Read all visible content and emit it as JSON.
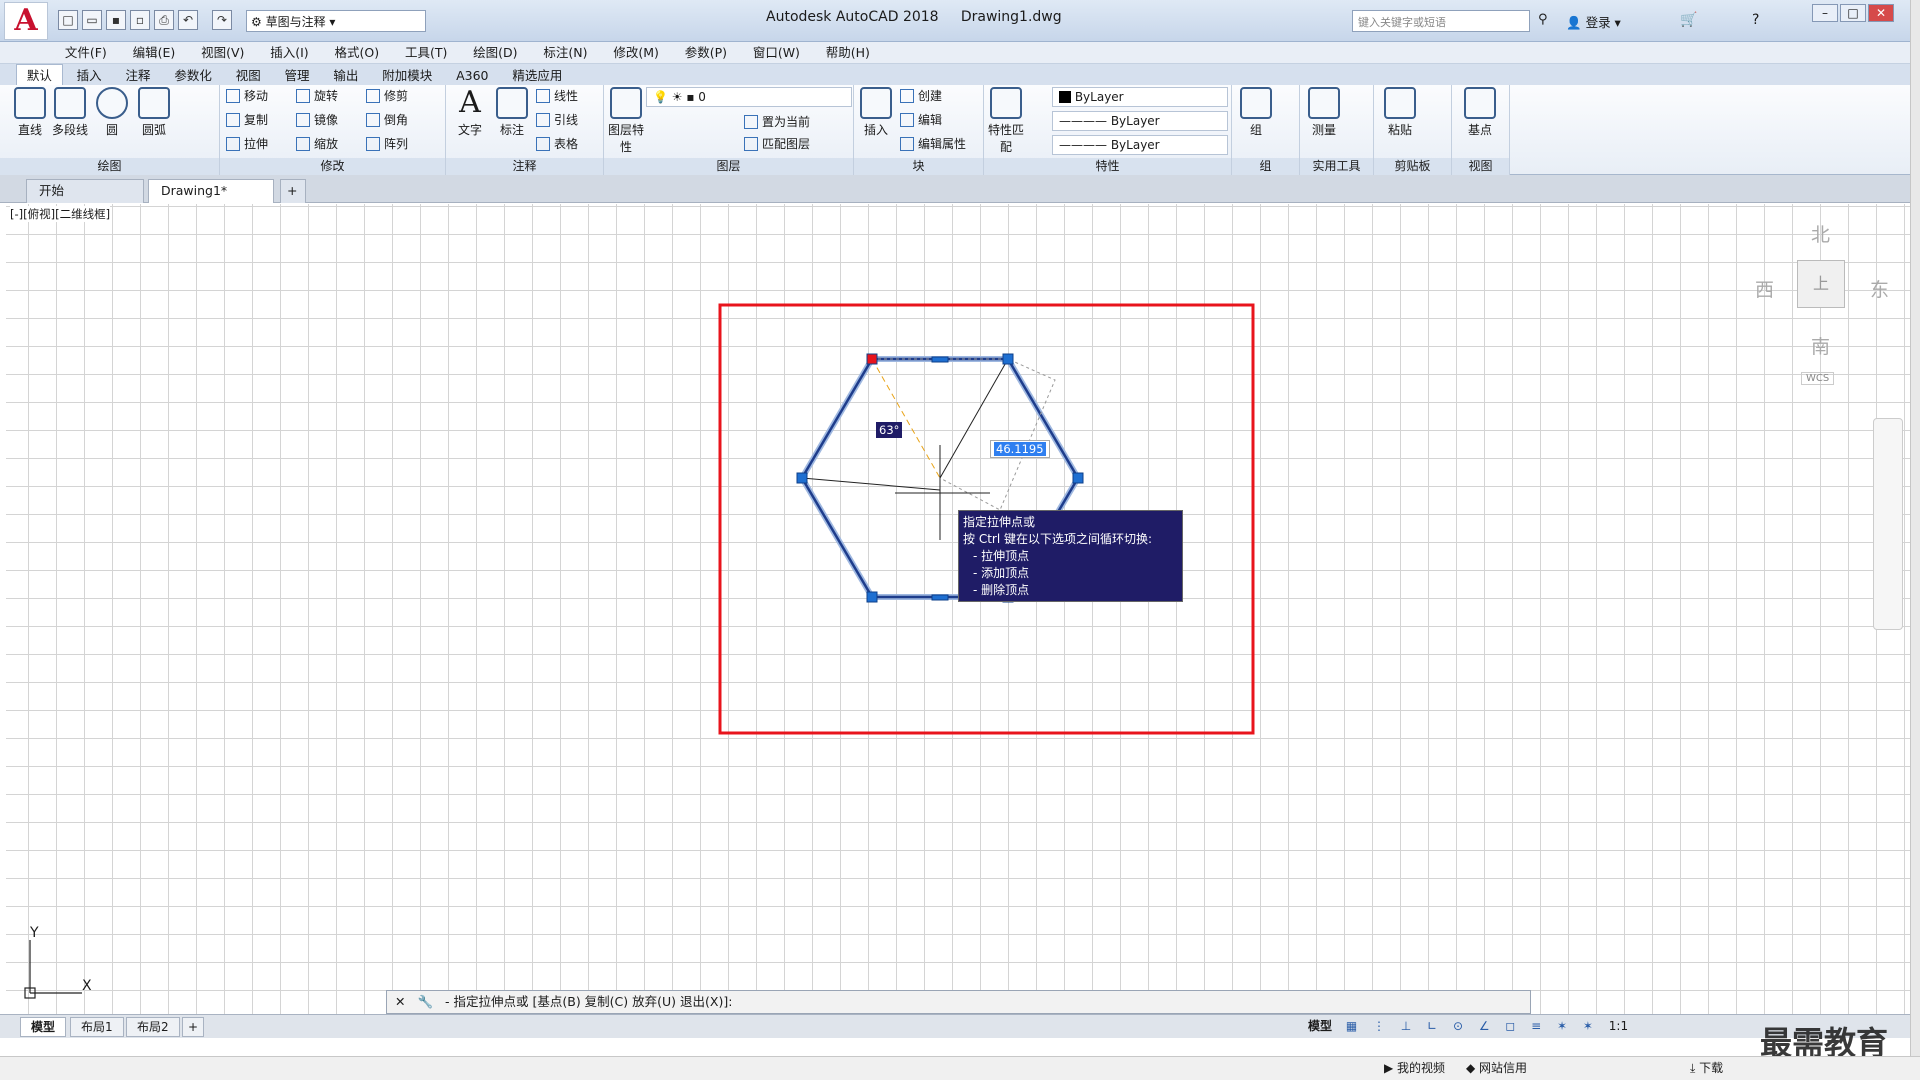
{
  "title": {
    "app": "Autodesk AutoCAD 2018",
    "file": "Drawing1.dwg",
    "workspace": "草图与注释",
    "search_placeholder": "键入关键字或短语",
    "login": "登录"
  },
  "menus": [
    "文件(F)",
    "编辑(E)",
    "视图(V)",
    "插入(I)",
    "格式(O)",
    "工具(T)",
    "绘图(D)",
    "标注(N)",
    "修改(M)",
    "参数(P)",
    "窗口(W)",
    "帮助(H)"
  ],
  "ribbon_tabs": [
    "默认",
    "插入",
    "注释",
    "参数化",
    "视图",
    "管理",
    "输出",
    "附加模块",
    "A360",
    "精选应用"
  ],
  "panels": {
    "draw": {
      "title": "绘图",
      "line": "直线",
      "polyline": "多段线",
      "circle": "圆",
      "arc": "圆弧"
    },
    "modify": {
      "title": "修改",
      "move": "移动",
      "rotate": "旋转",
      "trim": "修剪",
      "copy": "复制",
      "mirror": "镜像",
      "fillet": "倒角",
      "stretch": "拉伸",
      "scale": "缩放",
      "array": "阵列"
    },
    "annotation": {
      "title": "注释",
      "text": "文字",
      "dimension": "标注",
      "linear": "线性",
      "leader": "引线",
      "table": "表格"
    },
    "layers": {
      "title": "图层",
      "props": "图层特性",
      "current_layer": "0",
      "make_current": "置为当前",
      "match": "匹配图层"
    },
    "block": {
      "title": "块",
      "insert": "插入",
      "create": "创建",
      "edit": "编辑",
      "edit_attr": "编辑属性"
    },
    "properties": {
      "title": "特性",
      "match": "特性匹配",
      "color": "ByLayer",
      "linetype": "ByLayer",
      "lineweight": "ByLayer"
    },
    "groups": {
      "title": "组",
      "group": "组"
    },
    "utilities": {
      "title": "实用工具",
      "measure": "测量"
    },
    "clipboard": {
      "title": "剪贴板",
      "paste": "粘贴"
    },
    "view": {
      "title": "视图",
      "base": "基点"
    }
  },
  "doc_tabs": [
    "开始",
    "Drawing1*"
  ],
  "viewport_label": "[-][俯视][二维线框]",
  "viewcube": {
    "north": "北",
    "south": "南",
    "east": "东",
    "west": "西",
    "center": "上",
    "wcs": "WCS"
  },
  "dynamic_input": {
    "angle": "63°",
    "length": "46.1195"
  },
  "tooltip": {
    "line1": "指定拉伸点或",
    "line2": "按 Ctrl 键在以下选项之间循环切换:",
    "opt1": "- 拉伸顶点",
    "opt2": "- 添加顶点",
    "opt3": "- 删除顶点"
  },
  "ucs": {
    "x": "X",
    "y": "Y"
  },
  "command": "- 指定拉伸点或 [基点(B) 复制(C) 放弃(U) 退出(X)]:",
  "layout_tabs": [
    "模型",
    "布局1",
    "布局2"
  ],
  "status": {
    "model": "模型",
    "scale": "1:1"
  },
  "taskbar": {
    "video": "我的视频",
    "net": "网站信用",
    "download": "下载"
  },
  "watermark": "最需教育",
  "colors": {
    "accent": "#1f5ca8",
    "selection_box": "#e8141c",
    "tooltip_bg": "#1f1c66",
    "grip": "#1e6fd1"
  }
}
